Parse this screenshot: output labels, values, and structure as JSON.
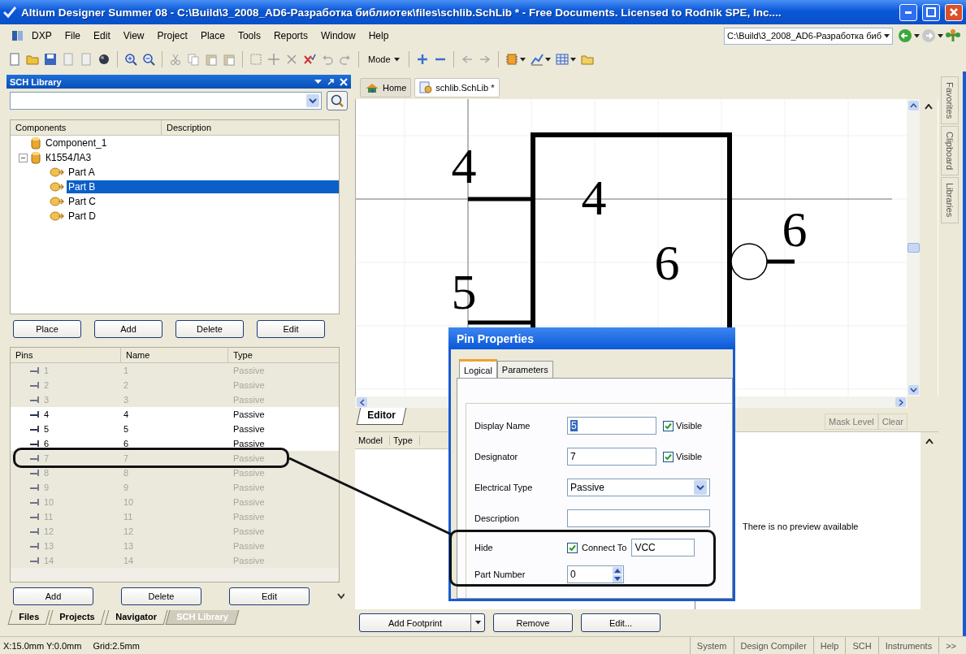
{
  "window": {
    "title": "Altium Designer Summer 08 - C:\\Build\\3_2008_AD6-Разработка библиотек\\files\\schlib.SchLib * - Free Documents. Licensed to Rodnik SPE, Inc...."
  },
  "menu": [
    "DXP",
    "File",
    "Edit",
    "View",
    "Project",
    "Place",
    "Tools",
    "Reports",
    "Window",
    "Help"
  ],
  "path_combo": {
    "value": "C:\\Build\\3_2008_AD6-Разработка биб"
  },
  "toolbar": {
    "mode_button": "Mode"
  },
  "sch_library": {
    "title": "SCH Library",
    "components": {
      "columns": [
        "Components",
        "Description"
      ],
      "items": [
        {
          "label": "Component_1",
          "selected": false
        },
        {
          "label": "К1554ЛА3",
          "selected": false,
          "expanded": true,
          "children": [
            {
              "label": "Part A",
              "selected": false
            },
            {
              "label": "Part B",
              "selected": true
            },
            {
              "label": "Part C",
              "selected": false
            },
            {
              "label": "Part D",
              "selected": false
            }
          ]
        }
      ]
    },
    "component_buttons": [
      "Place",
      "Add",
      "Delete",
      "Edit"
    ],
    "pins": {
      "columns": [
        "Pins",
        "Name",
        "Type"
      ],
      "rows": [
        {
          "pin": "1",
          "name": "1",
          "type": "Passive",
          "hidden": true
        },
        {
          "pin": "2",
          "name": "2",
          "type": "Passive",
          "hidden": true
        },
        {
          "pin": "3",
          "name": "3",
          "type": "Passive",
          "hidden": true
        },
        {
          "pin": "4",
          "name": "4",
          "type": "Passive",
          "hidden": false
        },
        {
          "pin": "5",
          "name": "5",
          "type": "Passive",
          "hidden": false
        },
        {
          "pin": "6",
          "name": "6",
          "type": "Passive",
          "hidden": false
        },
        {
          "pin": "7",
          "name": "7",
          "type": "Passive",
          "hidden": true
        },
        {
          "pin": "8",
          "name": "8",
          "type": "Passive",
          "hidden": true
        },
        {
          "pin": "9",
          "name": "9",
          "type": "Passive",
          "hidden": true
        },
        {
          "pin": "10",
          "name": "10",
          "type": "Passive",
          "hidden": true
        },
        {
          "pin": "11",
          "name": "11",
          "type": "Passive",
          "hidden": true
        },
        {
          "pin": "12",
          "name": "12",
          "type": "Passive",
          "hidden": true
        },
        {
          "pin": "13",
          "name": "13",
          "type": "Passive",
          "hidden": true
        },
        {
          "pin": "14",
          "name": "14",
          "type": "Passive",
          "hidden": true
        }
      ]
    },
    "pin_buttons": [
      "Add",
      "Delete",
      "Edit"
    ]
  },
  "panel_tabs": [
    {
      "label": "Files",
      "selected": false
    },
    {
      "label": "Projects",
      "selected": false
    },
    {
      "label": "Navigator",
      "selected": false
    },
    {
      "label": "SCH Library",
      "selected": true
    }
  ],
  "document_tabs": [
    {
      "label": "Home",
      "selected": false
    },
    {
      "label": "schlib.SchLib *",
      "selected": true
    }
  ],
  "canvas": {
    "labels": [
      "4",
      "4",
      "6",
      "6",
      "5"
    ]
  },
  "side_tabs": [
    "Favorites",
    "Clipboard",
    "Libraries"
  ],
  "models": {
    "tab": "Editor",
    "columns": [
      "Model",
      "Type"
    ],
    "mask_level": "Mask Level",
    "clear": "Clear",
    "preview_text": "There is no preview available",
    "buttons": [
      "Add Footprint",
      "Remove",
      "Edit..."
    ]
  },
  "dialog": {
    "title": "Pin Properties",
    "tabs": [
      {
        "label": "Logical",
        "selected": true
      },
      {
        "label": "Parameters",
        "selected": false
      }
    ],
    "display_name": {
      "label": "Display Name",
      "value": "5",
      "visible_label": "Visible",
      "visible": true
    },
    "designator": {
      "label": "Designator",
      "value": "7",
      "visible_label": "Visible",
      "visible": true
    },
    "electrical_type": {
      "label": "Electrical Type",
      "value": "Passive"
    },
    "description": {
      "label": "Description"
    },
    "hide": {
      "label": "Hide",
      "checked": true,
      "connect_to_label": "Connect To",
      "connect_to": "VCC"
    },
    "part_number": {
      "label": "Part Number",
      "value": "0"
    }
  },
  "status_bar": {
    "coordinates": "X:15.0mm Y:0.0mm",
    "grid": "Grid:2.5mm",
    "buttons": [
      "System",
      "Design Compiler",
      "Help",
      "SCH",
      "Instruments",
      ">>"
    ]
  }
}
